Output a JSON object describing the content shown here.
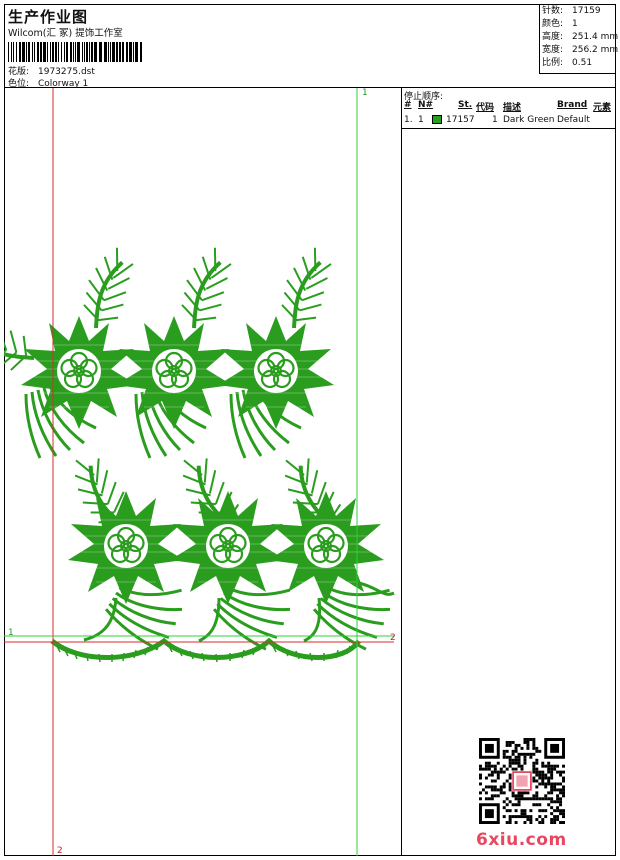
{
  "header": {
    "title": "生产作业图",
    "company": "Wilcom(汇 冢) 提饰工作室",
    "design_label": "花版:",
    "design_value": "1973275.dst",
    "colorway_label": "色位:",
    "colorway_value": "Colorway 1"
  },
  "stats": [
    {
      "key": "针数:",
      "value": "17159"
    },
    {
      "key": "颜色:",
      "value": "1"
    },
    {
      "key": "高度:",
      "value": "251.4 mm"
    },
    {
      "key": "宽度:",
      "value": "256.2 mm"
    },
    {
      "key": "比例:",
      "value": "0.51"
    }
  ],
  "stop_sequence": {
    "title": "停止顺序:",
    "columns": [
      "#",
      "N#",
      "St.",
      "代码",
      "描述",
      "Brand",
      "元素"
    ],
    "rows": [
      {
        "index": "1.",
        "needle": "1",
        "color": "#2a9d1f",
        "stitches": "17157",
        "code": "1",
        "description": "Dark Green",
        "brand": "Default",
        "element": ""
      }
    ]
  },
  "markers": {
    "top_green": "1",
    "left_green": "1",
    "right_red": "2",
    "bottom_red": "2"
  },
  "embroidery_color": "#2a9d1f",
  "guide_red": "#d92b2b",
  "guide_green": "#2fcf3a",
  "watermark": {
    "site": "6xiu.com"
  }
}
